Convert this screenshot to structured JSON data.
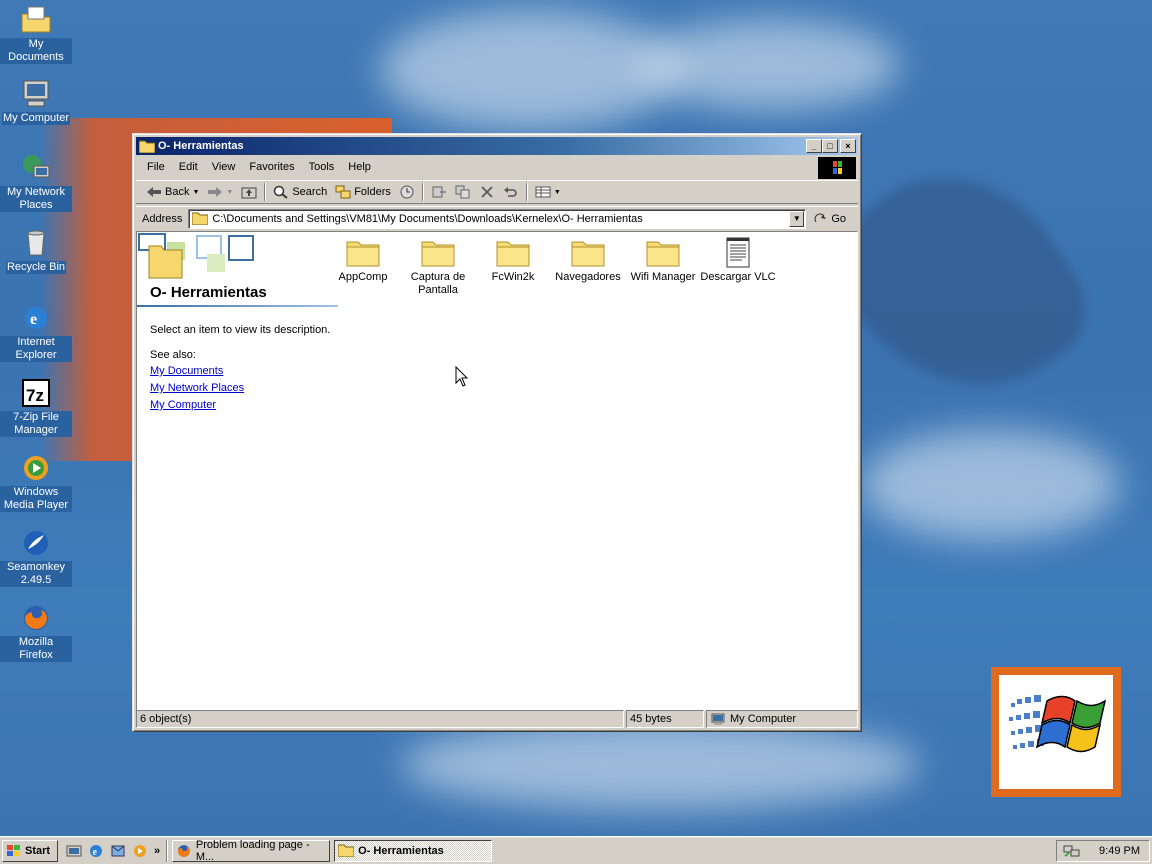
{
  "desktop": {
    "icons": [
      {
        "label": "My Documents",
        "icon": "my-documents-icon"
      },
      {
        "label": "My Computer",
        "icon": "my-computer-icon"
      },
      {
        "label": "My Network Places",
        "icon": "network-places-icon"
      },
      {
        "label": "Recycle Bin",
        "icon": "recycle-bin-icon"
      },
      {
        "label": "Internet Explorer",
        "icon": "internet-explorer-icon"
      },
      {
        "label": "7-Zip File Manager",
        "icon": "7zip-icon"
      },
      {
        "label": "Windows Media Player",
        "icon": "media-player-icon"
      },
      {
        "label": "Seamonkey 2.49.5",
        "icon": "seamonkey-icon"
      },
      {
        "label": "Mozilla Firefox",
        "icon": "firefox-icon"
      }
    ]
  },
  "window": {
    "title": "O- Herramientas",
    "buttons": {
      "minimize": "_",
      "maximize": "□",
      "close": "×"
    },
    "menu": [
      "File",
      "Edit",
      "View",
      "Favorites",
      "Tools",
      "Help"
    ],
    "toolbar": {
      "back": "Back",
      "search": "Search",
      "folders": "Folders"
    },
    "address": {
      "label": "Address",
      "value": "C:\\Documents and Settings\\VM81\\My Documents\\Downloads\\Kernelex\\O- Herramientas",
      "go": "Go"
    },
    "webview": {
      "folder_title": "O- Herramientas",
      "description": "Select an item to view its description.",
      "see_also": "See also:",
      "links": [
        "My Documents",
        "My Network Places",
        "My Computer"
      ]
    },
    "items": [
      {
        "name": "AppComp",
        "type": "folder"
      },
      {
        "name": "Captura de Pantalla",
        "type": "folder"
      },
      {
        "name": "FcWin2k",
        "type": "folder"
      },
      {
        "name": "Navegadores",
        "type": "folder"
      },
      {
        "name": "Wifi Manager",
        "type": "folder"
      },
      {
        "name": "Descargar VLC",
        "type": "text-file"
      }
    ],
    "status": {
      "objects": "6 object(s)",
      "size": "45 bytes",
      "location": "My Computer"
    }
  },
  "taskbar": {
    "start": "Start",
    "tasks": [
      {
        "label": "Problem loading page - M...",
        "icon": "firefox-icon",
        "active": false
      },
      {
        "label": "O- Herramientas",
        "icon": "folder-icon",
        "active": true
      }
    ],
    "clock": "9:49 PM"
  },
  "colors": {
    "titlebar_start": "#0a246a",
    "titlebar_end": "#a6caf0",
    "desktop": "#3f79b6",
    "link": "#0000cc"
  }
}
